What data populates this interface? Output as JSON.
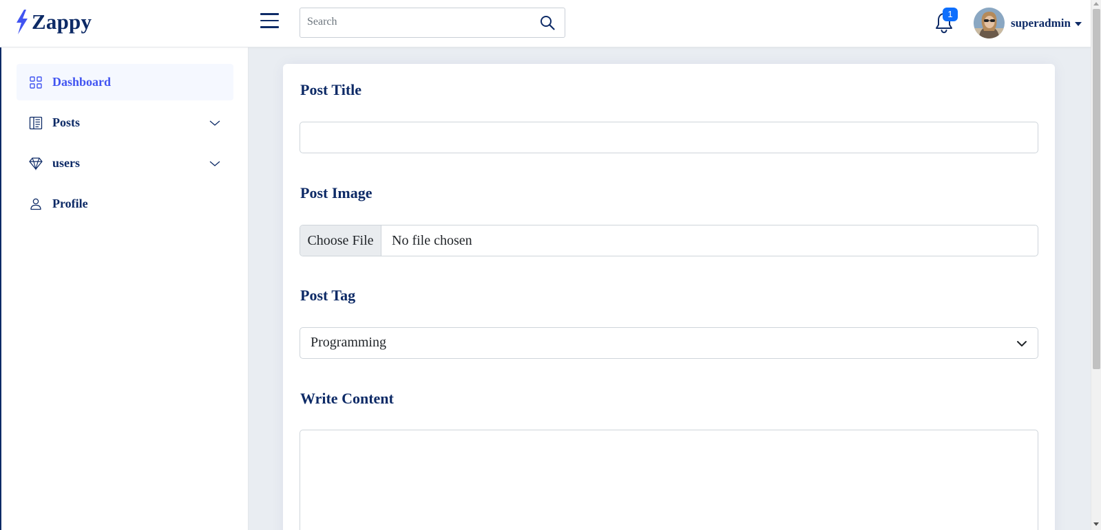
{
  "app": {
    "name": "Zappy"
  },
  "header": {
    "search_placeholder": "Search",
    "notification_count": "1",
    "username": "superadmin"
  },
  "sidebar": {
    "items": [
      {
        "label": "Dashboard",
        "icon": "grid-icon",
        "active": true
      },
      {
        "label": "Posts",
        "icon": "layout-text-sidebar-icon",
        "expandable": true
      },
      {
        "label": "users",
        "icon": "gem-icon",
        "expandable": true
      },
      {
        "label": "Profile",
        "icon": "person-icon"
      }
    ]
  },
  "form": {
    "title_label": "Post Title",
    "title_value": "",
    "image_label": "Post Image",
    "file_button": "Choose File",
    "file_status": "No file chosen",
    "tag_label": "Post Tag",
    "tag_selected": "Programming",
    "content_label": "Write Content",
    "content_value": ""
  },
  "colors": {
    "primary_text": "#0d2a66",
    "accent": "#4154f1",
    "badge": "#0d6efd",
    "background": "#e9edf2"
  }
}
